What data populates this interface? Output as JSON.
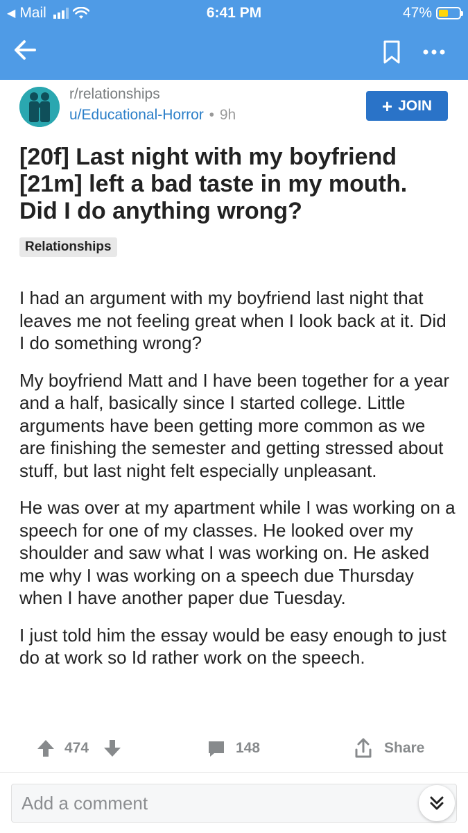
{
  "status_bar": {
    "carrier": "Mail",
    "time": "6:41 PM",
    "battery": "47%",
    "battery_level": 0.47
  },
  "nav": {
    "back_icon": "arrow-left-icon",
    "bookmark_icon": "bookmark-icon",
    "more_icon": "more-dots-icon"
  },
  "post": {
    "subreddit": "r/relationships",
    "author": "u/Educational-Horror",
    "separator": "•",
    "age": "9h",
    "join_label": "JOIN",
    "title": "[20f] Last night with my boyfriend [21m] left a bad taste in my mouth. Did I do anything wrong?",
    "flair": "Relationships",
    "paragraphs": [
      "I had an argument with my boyfriend last night that leaves me not feeling great when I look back at it. Did I do something wrong?",
      "My boyfriend Matt and I have been together for a year and a half, basically since I started college. Little arguments have been getting more common as we are finishing the semester and getting stressed about stuff, but last night felt especially unpleasant.",
      "He was over at my apartment while I was working on a speech for one of my classes. He looked over my shoulder and saw what I was working on. He asked me why I was working on a speech due Thursday when I have another paper due Tuesday.",
      "I just told him the essay would be easy enough to just do at work so Id rather work on the speech."
    ]
  },
  "actions": {
    "votes": "474",
    "comments": "148",
    "share_label": "Share"
  },
  "comment": {
    "placeholder": "Add a comment"
  },
  "colors": {
    "header": "#4f9be6",
    "join": "#2a73c8",
    "author_link": "#2a7ec8",
    "battery_fill": "#ffd60a"
  }
}
